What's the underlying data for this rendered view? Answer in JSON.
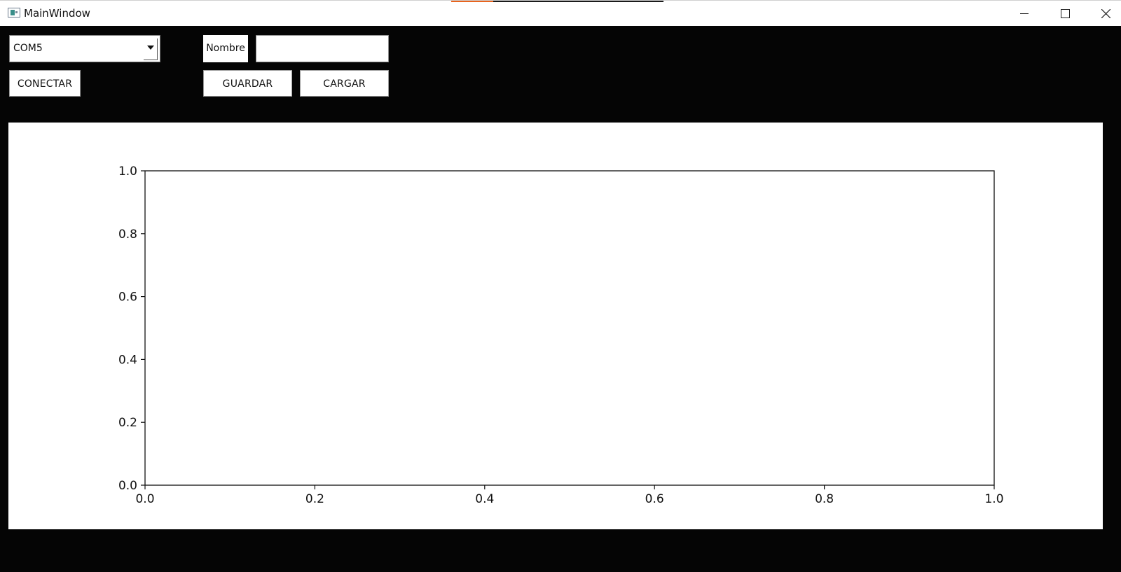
{
  "window": {
    "title": "MainWindow",
    "controls": {
      "minimize": "minimize",
      "maximize": "maximize",
      "close": "close"
    }
  },
  "toolbar": {
    "port_selected": "COM5",
    "connect_label": "CONECTAR",
    "name_label": "Nombre",
    "name_value": "",
    "save_label": "GUARDAR",
    "load_label": "CARGAR"
  },
  "chart_data": {
    "type": "line",
    "title": "",
    "xlabel": "",
    "ylabel": "",
    "xlim": [
      0.0,
      1.0
    ],
    "ylim": [
      0.0,
      1.0
    ],
    "xticks": [
      "0.0",
      "0.2",
      "0.4",
      "0.6",
      "0.8",
      "1.0"
    ],
    "yticks": [
      "0.0",
      "0.2",
      "0.4",
      "0.6",
      "0.8",
      "1.0"
    ],
    "series": [],
    "grid": false
  },
  "colors": {
    "window_background": "#050505",
    "plot_background": "#ffffff",
    "titlebar_accent": "#e8641e"
  }
}
